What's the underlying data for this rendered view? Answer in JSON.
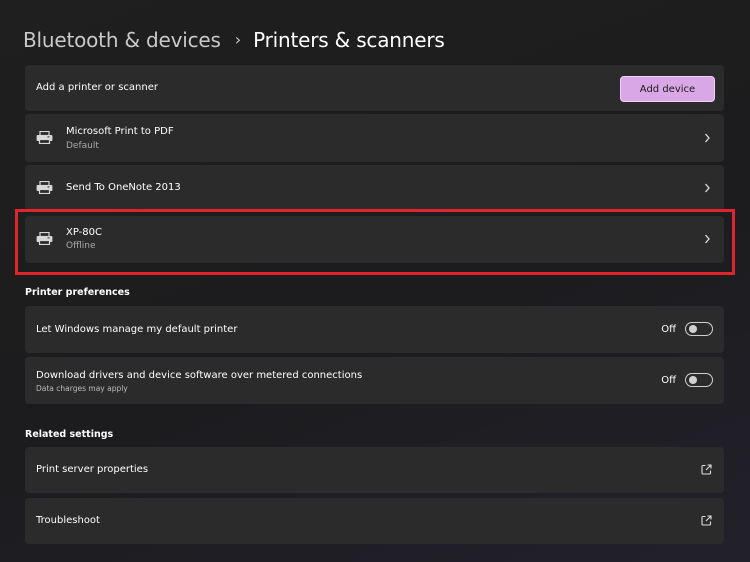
{
  "breadcrumb": {
    "parent": "Bluetooth & devices",
    "separator": "›",
    "current": "Printers & scanners"
  },
  "add_printer": {
    "label": "Add a printer or scanner",
    "button_label": "Add device"
  },
  "printers": [
    {
      "name": "Microsoft Print to PDF",
      "status": "Default",
      "icon": "printer-icon"
    },
    {
      "name": "Send To OneNote 2013",
      "status": "",
      "icon": "printer-icon"
    },
    {
      "name": "XP-80C",
      "status": "Offline",
      "icon": "printer-icon",
      "highlighted": true
    }
  ],
  "printer_preferences": {
    "header": "Printer preferences",
    "items": [
      {
        "label": "Let Windows manage my default printer",
        "sublabel": "",
        "state": "Off"
      },
      {
        "label": "Download drivers and device software over metered connections",
        "sublabel": "Data charges may apply",
        "state": "Off"
      }
    ]
  },
  "related_settings": {
    "header": "Related settings",
    "items": [
      {
        "label": "Print server properties",
        "icon": "external-link-icon"
      },
      {
        "label": "Troubleshoot",
        "icon": "external-link-icon"
      }
    ]
  },
  "colors": {
    "accent": "#d9a6e6",
    "card_background": "#2b2b2b",
    "highlight_border": "#e0242e"
  }
}
